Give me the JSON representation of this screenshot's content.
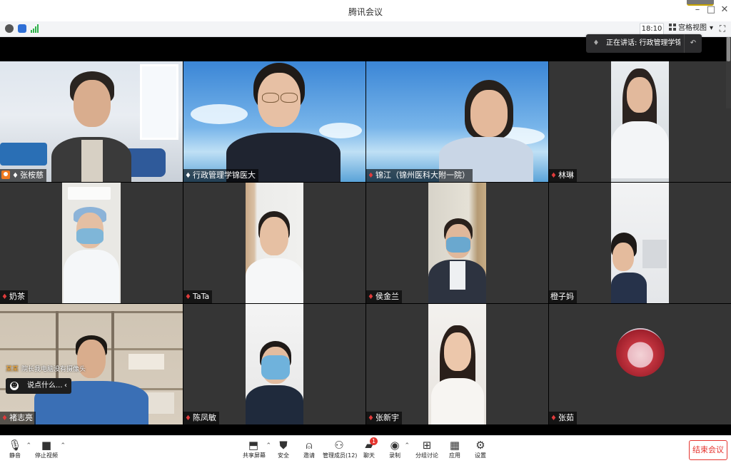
{
  "window": {
    "title": "腾讯会议"
  },
  "infobar": {
    "time": "18:10",
    "grid_view_label": "宫格视图"
  },
  "speaking_indicator": {
    "text": "正在讲话: 行政管理学锦医..."
  },
  "participants": [
    {
      "name": "张桉慈",
      "mic": "on",
      "host": true
    },
    {
      "name": "行政管理学锦医大",
      "mic": "on"
    },
    {
      "name": "锦江（锦州医科大附一院）",
      "mic": "off"
    },
    {
      "name": "林琳",
      "mic": "off"
    },
    {
      "name": "奶茶",
      "mic": "off"
    },
    {
      "name": "TaTa",
      "mic": "off"
    },
    {
      "name": "侯金兰",
      "mic": "off"
    },
    {
      "name": "橙子妈",
      "mic": "none"
    },
    {
      "name": "褚志亮",
      "mic": "off"
    },
    {
      "name": "陈凤敏",
      "mic": "off"
    },
    {
      "name": "张新宇",
      "mic": "off"
    },
    {
      "name": "张茹",
      "mic": "off"
    }
  ],
  "chat_overlay": {
    "sender": "某某",
    "notice": "院长我电脑没有摄像头",
    "input_placeholder": "说点什么...",
    "collapse_glyph": "‹"
  },
  "toolbar": {
    "mute": "静音",
    "stop_video": "停止视频",
    "share_screen": "共享屏幕",
    "security": "安全",
    "invite": "邀请",
    "manage_members": "管理成员(12)",
    "chat": "聊天",
    "chat_badge": "1",
    "record": "录制",
    "breakout": "分组讨论",
    "apps": "应用",
    "settings": "设置",
    "end_meeting": "结束会议"
  },
  "colors": {
    "end_red": "#e5352f",
    "host_orange": "#f07a20",
    "tile_gray": "#353535"
  }
}
